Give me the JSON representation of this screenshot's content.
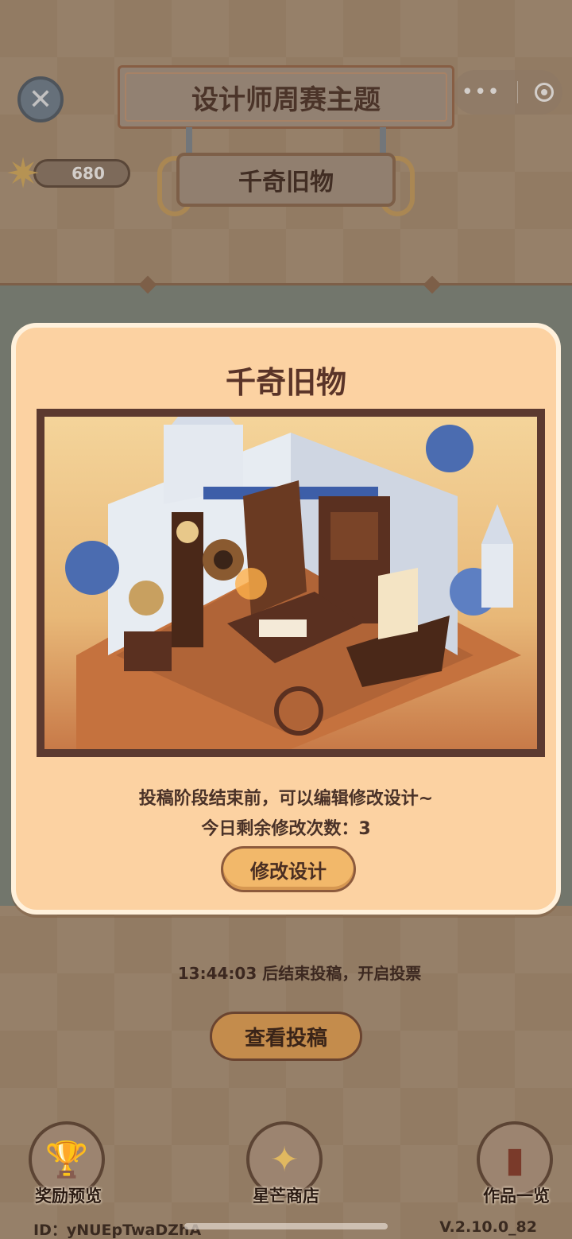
{
  "header": {
    "title": "设计师周赛主题",
    "theme_name": "千奇旧物",
    "star_count": "680"
  },
  "modal": {
    "title": "千奇旧物",
    "artwork_alt": "",
    "description": "投稿阶段结束前，可以编辑修改设计~",
    "remaining_edits": "今日剩余修改次数：3",
    "edit_button": "修改设计"
  },
  "main": {
    "countdown": "13:44:03 后结束投稿，开启投票",
    "view_button": "查看投稿"
  },
  "nav": {
    "items": [
      {
        "label": "奖励预览",
        "icon": "trophy-icon"
      },
      {
        "label": "星芒商店",
        "icon": "star-compass-icon"
      },
      {
        "label": "作品一览",
        "icon": "book-icon"
      }
    ]
  },
  "footer": {
    "id": "ID：yNUEpTwaDZhA",
    "version": "V.2.10.0_82"
  },
  "colors": {
    "modal_bg": "#fcd2a2",
    "button": "#f2b86a",
    "text_dark": "#4a3228"
  }
}
